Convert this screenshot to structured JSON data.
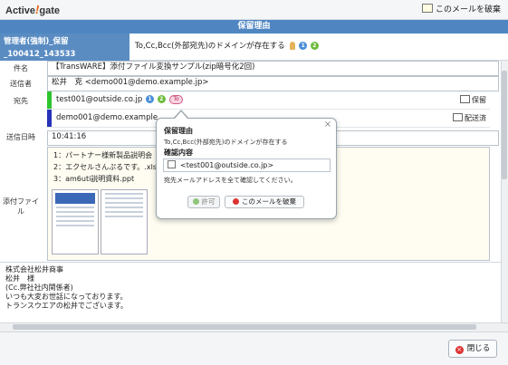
{
  "header": {
    "logo_text": "Active",
    "logo_mark": "!",
    "logo_text2": "gate",
    "discard_link": "このメールを破棄"
  },
  "title": "保留理由",
  "sender_cell": {
    "line1": "管理者(強制)_保留",
    "line2": "_100412_143533"
  },
  "reason": {
    "text": "To,Cc,Bcc(外部宛先)のドメインが存在する",
    "badge1": "1",
    "badge2": "2"
  },
  "form": {
    "subject_label": "件名",
    "subject": "【TransWARE】添付ファイル変換サンプル(zip暗号化2回)",
    "from_label": "送信者",
    "from": "松井　克 <demo001@demo.example.jp>",
    "to_label": "宛先",
    "recipients": [
      {
        "address": "test001@outside.co.jp",
        "badge1": "1",
        "badge2": "2",
        "type": "To",
        "action": "保留",
        "bar_color": "#2ec42e"
      },
      {
        "address": "demo001@demo.example",
        "action": "配送済",
        "bar_color": "#2732b8"
      }
    ],
    "date_label": "送信日時",
    "date": "10:41:16",
    "attach_label": "添付ファイル",
    "attachments": [
      "1：パートナー様新製品説明会（",
      "2：エクセルさんぷるです。.xls",
      "3：am6uti説明資料.ppt"
    ]
  },
  "body_lines": [
    "株式会社松井商事",
    "松井　様",
    "(Cc.弊社社内関係者)",
    "",
    "いつも大変お世話になっております。",
    "トランスウエアの松井でございます。"
  ],
  "popup": {
    "title": "保留理由",
    "reason": "To,Cc,Bcc(外部宛先)のドメインが存在する",
    "confirm_title": "確認内容",
    "confirm_item": "<test001@outside.co.jp>",
    "note": "宛先メールアドレスを全て確認してください。",
    "allow_button": "許可",
    "discard_button": "このメールを破棄"
  },
  "footer": {
    "close_button": "閉じる"
  },
  "colors": {
    "title_bar": "#4f86c2",
    "accent_orange": "#e8600b"
  }
}
